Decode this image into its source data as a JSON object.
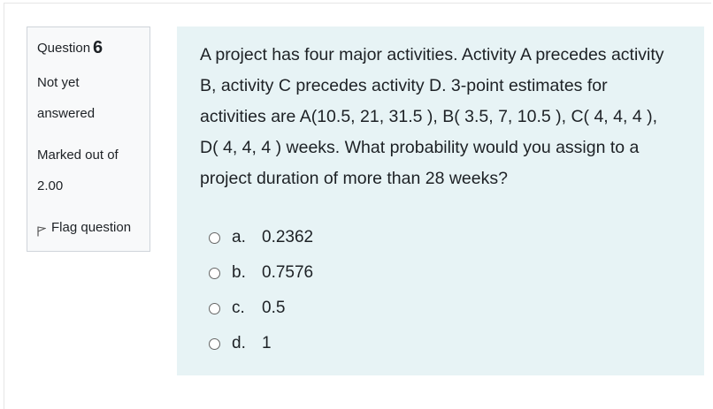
{
  "question_info": {
    "label": "Question",
    "number": "6",
    "state_line1": "Not yet",
    "state_line2": "answered",
    "grade_line1": "Marked out of",
    "grade_line2": "2.00",
    "flag_label": "Flag question",
    "flag_icon": "flag-icon"
  },
  "question": {
    "lines": [
      "A project has four major activities. Activity A precedes activity",
      "B, activity C precedes activity D. 3-point estimates for",
      "activities are A(10.5, 21, 31.5 ), B( 3.5, 7, 10.5 ), C( 4, 4, 4 ),",
      "D( 4, 4, 4 ) weeks. What probability would you assign to a",
      "project duration of more than 28 weeks?"
    ]
  },
  "answers": [
    {
      "letter": "a.",
      "value": "0.2362",
      "selected": false
    },
    {
      "letter": "b.",
      "value": "0.7576",
      "selected": false
    },
    {
      "letter": "c.",
      "value": "0.5",
      "selected": false
    },
    {
      "letter": "d.",
      "value": "1",
      "selected": false
    }
  ],
  "colors": {
    "content_background": "#e7f3f5",
    "info_background": "#f8f9fa",
    "text": "#1d2125"
  }
}
